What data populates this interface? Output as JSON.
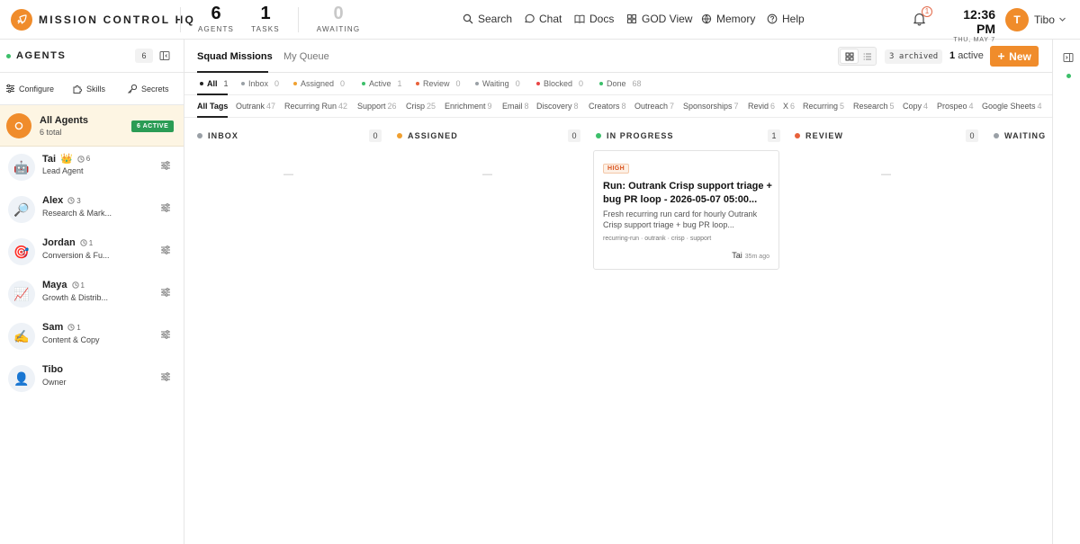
{
  "header": {
    "app_title": "MISSION CONTROL HQ",
    "stats": [
      {
        "value": "6",
        "label": "AGENTS"
      },
      {
        "value": "1",
        "label": "TASKS"
      },
      {
        "value": "0",
        "label": "AWAITING"
      }
    ],
    "nav": [
      {
        "label": "Search",
        "icon": "search-icon"
      },
      {
        "label": "Chat",
        "icon": "chat-icon"
      },
      {
        "label": "Docs",
        "icon": "docs-icon"
      },
      {
        "label": "GOD View",
        "icon": "grid-icon"
      },
      {
        "label": "Memory",
        "icon": "memory-icon"
      },
      {
        "label": "Help",
        "icon": "help-icon"
      }
    ],
    "notifications_count": "1",
    "time": "12:36 PM",
    "date": "THU, MAY 7",
    "user_initial": "T",
    "user_name": "Tibo",
    "accent_color": "#f08c2b"
  },
  "sidebar": {
    "title": "AGENTS",
    "count": "6",
    "actions": [
      {
        "label": "Configure",
        "icon": "configure-icon"
      },
      {
        "label": "Skills",
        "icon": "puzzle-icon"
      },
      {
        "label": "Secrets",
        "icon": "key-icon"
      }
    ],
    "all_agents": {
      "name": "All Agents",
      "subtitle": "6 total",
      "badge": "6 ACTIVE"
    },
    "agents": [
      {
        "name": "Tai",
        "emoji": "🤖",
        "crown": "👑",
        "tasks": "6",
        "role": "Lead Agent"
      },
      {
        "name": "Alex",
        "emoji": "🔎",
        "tasks": "3",
        "role": "Research & Mark..."
      },
      {
        "name": "Jordan",
        "emoji": "🎯",
        "tasks": "1",
        "role": "Conversion & Fu..."
      },
      {
        "name": "Maya",
        "emoji": "📈",
        "tasks": "1",
        "role": "Growth & Distrib..."
      },
      {
        "name": "Sam",
        "emoji": "✍️",
        "tasks": "1",
        "role": "Content & Copy"
      },
      {
        "name": "Tibo",
        "emoji": "👤",
        "tasks": "",
        "role": "Owner"
      }
    ]
  },
  "main": {
    "tabs": [
      {
        "label": "Squad Missions",
        "active": true
      },
      {
        "label": "My Queue",
        "active": false
      }
    ],
    "archived_label": "3 archived",
    "active_count": "1",
    "active_label": "active",
    "new_label": "New",
    "status_filters": [
      {
        "label": "All",
        "count": "1",
        "color": "#222222"
      },
      {
        "label": "Inbox",
        "count": "0",
        "color": "#9aa0a6"
      },
      {
        "label": "Assigned",
        "count": "0",
        "color": "#f0a030"
      },
      {
        "label": "Active",
        "count": "1",
        "color": "#3cbf6a"
      },
      {
        "label": "Review",
        "count": "0",
        "color": "#e8613a"
      },
      {
        "label": "Waiting",
        "count": "0",
        "color": "#9aa0a6"
      },
      {
        "label": "Blocked",
        "count": "0",
        "color": "#e84545"
      },
      {
        "label": "Done",
        "count": "68",
        "color": "#3cbf6a"
      }
    ],
    "tags": [
      {
        "label": "All Tags",
        "count": ""
      },
      {
        "label": "Outrank",
        "count": "47"
      },
      {
        "label": "Recurring Run",
        "count": "42"
      },
      {
        "label": "Support",
        "count": "26"
      },
      {
        "label": "Crisp",
        "count": "25"
      },
      {
        "label": "Enrichment",
        "count": "9"
      },
      {
        "label": "Email",
        "count": "8"
      },
      {
        "label": "Discovery",
        "count": "8"
      },
      {
        "label": "Creators",
        "count": "8"
      },
      {
        "label": "Outreach",
        "count": "7"
      },
      {
        "label": "Sponsorships",
        "count": "7"
      },
      {
        "label": "Revid",
        "count": "6"
      },
      {
        "label": "X",
        "count": "6"
      },
      {
        "label": "Recurring",
        "count": "5"
      },
      {
        "label": "Research",
        "count": "5"
      },
      {
        "label": "Copy",
        "count": "4"
      },
      {
        "label": "Prospeo",
        "count": "4"
      },
      {
        "label": "Google Sheets",
        "count": "4"
      }
    ],
    "columns": [
      {
        "title": "INBOX",
        "count": "0",
        "color": "#9aa0a6",
        "empty": "—"
      },
      {
        "title": "ASSIGNED",
        "count": "0",
        "color": "#f0a030",
        "empty": "—"
      },
      {
        "title": "IN PROGRESS",
        "count": "1",
        "color": "#3cbf6a",
        "empty": ""
      },
      {
        "title": "REVIEW",
        "count": "0",
        "color": "#e8613a",
        "empty": "—"
      },
      {
        "title": "WAITING",
        "count": "",
        "color": "#9aa0a6",
        "empty": ""
      }
    ],
    "card": {
      "priority": "HIGH",
      "title": "Run: Outrank Crisp support triage + bug PR loop - 2026-05-07 05:00...",
      "description": "Fresh recurring run card for hourly Outrank Crisp support triage + bug PR loop...",
      "tags": "recurring-run · outrank · crisp · support",
      "assignee": "Tai",
      "time_ago": "35m ago"
    }
  }
}
